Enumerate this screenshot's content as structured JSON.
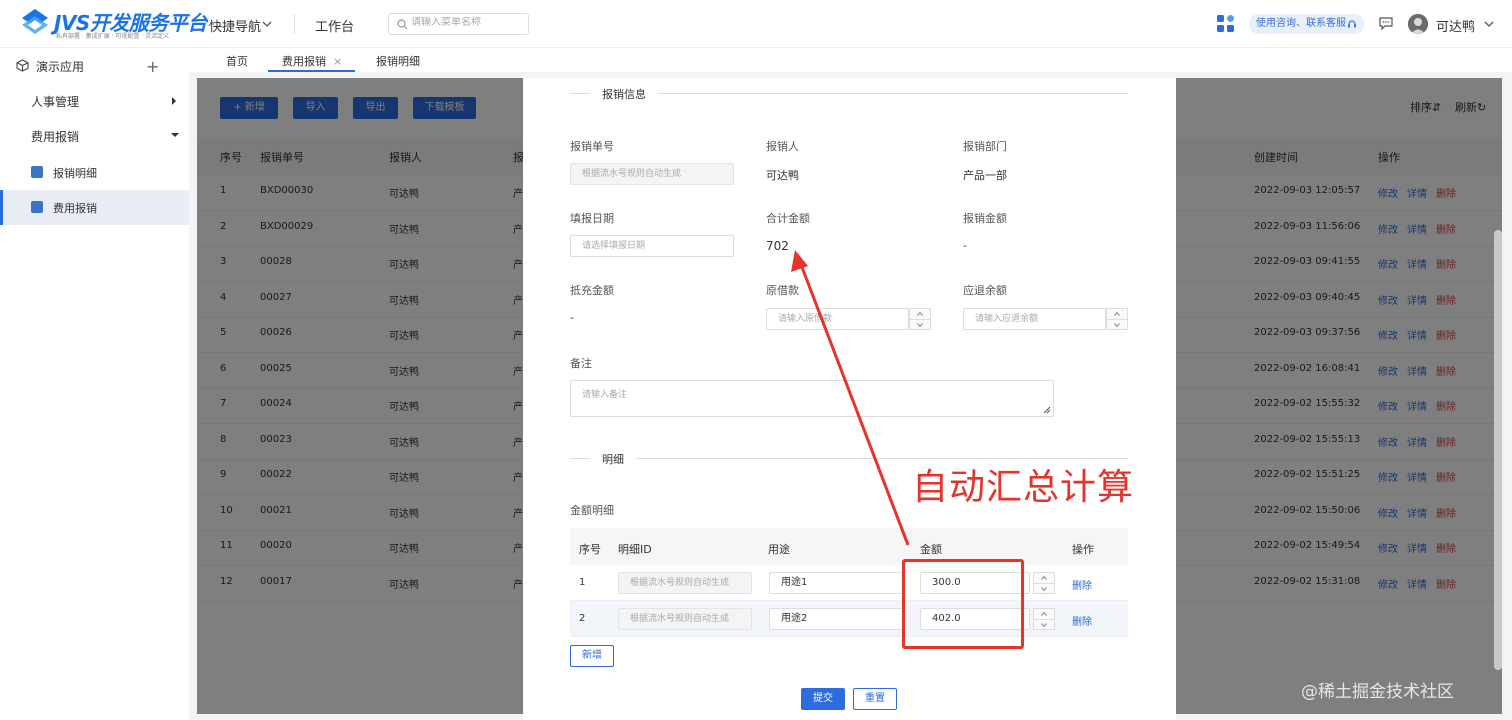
{
  "header": {
    "logo_title": "JVS开发服务平台",
    "logo_sub": "私有部署 · 集成扩展 · 可视配置 · 灵活定义",
    "quick_nav": "快捷导航",
    "workbench": "工作台",
    "search_placeholder": "请输入菜单名称",
    "consult_label": "使用咨询、联系客服",
    "user_name": "可达鸭"
  },
  "sidebar": {
    "app_label": "演示应用",
    "items": [
      {
        "label": "人事管理"
      },
      {
        "label": "费用报销"
      }
    ],
    "subitems": [
      {
        "label": "报销明细"
      },
      {
        "label": "费用报销"
      }
    ]
  },
  "tabs": [
    {
      "label": "首页"
    },
    {
      "label": "费用报销"
    },
    {
      "label": "报销明细"
    }
  ],
  "toolbar": {
    "add": "+ 新增",
    "import": "导入",
    "export": "导出",
    "download": "下载模板",
    "sort": "排序⇵",
    "refresh": "刷新↻"
  },
  "table": {
    "headers": {
      "index": "序号",
      "number": "报销单号",
      "person": "报销人",
      "col4": "报",
      "created": "创建时间",
      "ops": "操作"
    },
    "ops": {
      "edit": "修改",
      "detail": "详情",
      "delete": "删除"
    },
    "rows": [
      {
        "idx": "1",
        "no": "BXD00030",
        "person": "可达鸭",
        "c4": "产",
        "time": "2022-09-03 12:05:57"
      },
      {
        "idx": "2",
        "no": "BXD00029",
        "person": "可达鸭",
        "c4": "产",
        "time": "2022-09-03 11:56:06"
      },
      {
        "idx": "3",
        "no": "00028",
        "person": "可达鸭",
        "c4": "产",
        "time": "2022-09-03 09:41:55"
      },
      {
        "idx": "4",
        "no": "00027",
        "person": "可达鸭",
        "c4": "产",
        "time": "2022-09-03 09:40:45"
      },
      {
        "idx": "5",
        "no": "00026",
        "person": "可达鸭",
        "c4": "产",
        "time": "2022-09-03 09:37:56"
      },
      {
        "idx": "6",
        "no": "00025",
        "person": "可达鸭",
        "c4": "产",
        "time": "2022-09-02 16:08:41"
      },
      {
        "idx": "7",
        "no": "00024",
        "person": "可达鸭",
        "c4": "产",
        "time": "2022-09-02 15:55:32"
      },
      {
        "idx": "8",
        "no": "00023",
        "person": "可达鸭",
        "c4": "产",
        "time": "2022-09-02 15:55:13"
      },
      {
        "idx": "9",
        "no": "00022",
        "person": "可达鸭",
        "c4": "产",
        "time": "2022-09-02 15:51:25"
      },
      {
        "idx": "10",
        "no": "00021",
        "person": "可达鸭",
        "c4": "产",
        "time": "2022-09-02 15:50:06"
      },
      {
        "idx": "11",
        "no": "00020",
        "person": "可达鸭",
        "c4": "产",
        "time": "2022-09-02 15:49:54"
      },
      {
        "idx": "12",
        "no": "00017",
        "person": "可达鸭",
        "c4": "产",
        "time": "2022-09-02 15:31:08"
      }
    ]
  },
  "modal": {
    "section_info": "报销信息",
    "section_detail": "明细",
    "fields": {
      "bill_no_label": "报销单号",
      "bill_no_placeholder": "根据流水号规则自动生成",
      "person_label": "报销人",
      "person_value": "可达鸭",
      "dept_label": "报销部门",
      "dept_value": "产品一部",
      "date_label": "填报日期",
      "date_placeholder": "请选择填报日期",
      "total_label": "合计金额",
      "total_value": "702",
      "reimb_label": "报销金额",
      "reimb_value": "-",
      "offset_label": "抵充金额",
      "offset_value": "-",
      "borrow_label": "原借款",
      "borrow_placeholder": "请输入原借款",
      "refund_label": "应退余额",
      "refund_placeholder": "请输入应退余额",
      "remark_label": "备注",
      "remark_placeholder": "请输入备注"
    },
    "amount_detail_label": "金额明细",
    "detail_headers": {
      "idx": "序号",
      "id": "明细ID",
      "purpose": "用途",
      "amount": "金额",
      "ops": "操作"
    },
    "detail_rows": [
      {
        "idx": "1",
        "id_placeholder": "根据流水号规则自动生成",
        "purpose": "用途1",
        "amount": "300.0",
        "op": "删除"
      },
      {
        "idx": "2",
        "id_placeholder": "根据流水号规则自动生成",
        "purpose": "用途2",
        "amount": "402.0",
        "op": "删除"
      }
    ],
    "add_row": "新增",
    "submit": "提交",
    "reset": "重置"
  },
  "annotation": {
    "text": "自动汇总计算",
    "color": "#e8332a"
  },
  "watermark": "@稀土掘金技术社区",
  "colors": {
    "primary": "#2d6cdf",
    "danger": "#e04040"
  }
}
